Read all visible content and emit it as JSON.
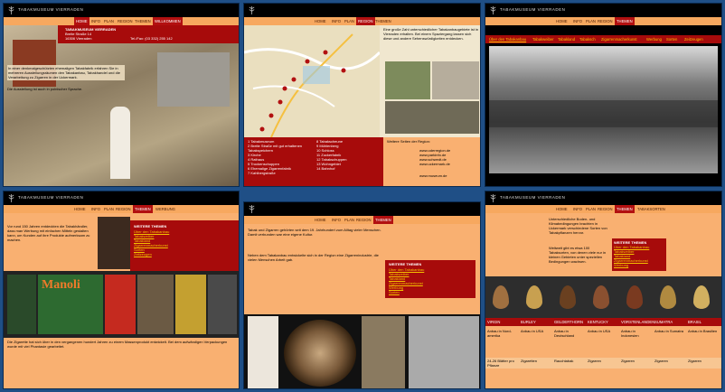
{
  "site_title": "TABAKMUSEUM VIERRADEN",
  "nav": [
    "HOME",
    "INFO",
    "PLAN",
    "REGION",
    "THEMEN"
  ],
  "panels": {
    "p1": {
      "active": "HOME",
      "sub": "WILLKOMMEN",
      "address": [
        "TABAKMUSEUM VIERRADEN",
        "Breite Straße 14",
        "16306 Vierraden",
        "Tel./Fax: (03 332) 255 142"
      ],
      "intro": "In einer denkmalgeschützten ehemaligen Tabakfabrik erfahren Sie in mehreren Ausstellungsräumen den Tabakanbau, Tabakhandel und die Verarbeitung zu Zigarren in der Uckermark.",
      "english": "Die Ausstellung ist auch in polnischer Sprache."
    },
    "p2": {
      "active": "REGION",
      "intro": "Eine große Zahl unterschiedlicher Tabakanbaugebiete ist in Vierraden erhalten. Bei einem Spaziergang lassen sich diese und andere Sehenswürdigkeiten entdecken.",
      "list_left": [
        "1 Tabakmuseum",
        "2 Breite Straße mit gut erhaltenen Tabakspeichern",
        "3 Kirche",
        "4 Rathaus",
        "5 Trockenschuppen",
        "6 Ehemalige Zigarrenfabrik",
        "7 Kahlbergstraße"
      ],
      "list_right": [
        "8 Tabakscheune",
        "9 Mühlenberg",
        "10 Schloss",
        "11 Zuckerfabrik",
        "12 Tabakschuppen",
        "13 Wohngebiet",
        "14 Bahnhof"
      ],
      "links_title": "Weitere Seiten der Region:",
      "links": [
        "www.oderregion.de",
        "www.parkinfo.de",
        "www.schwedt.de",
        "www.uckermark.de",
        "www.museum.de"
      ]
    },
    "p3": {
      "tabs": [
        "Über den Tabakanbau",
        "Tabakweiber",
        "Tabakland",
        "Tabaksch",
        "Zigarrenmacherkunst",
        "Werbung",
        "Sorten",
        "Zeitzeugen"
      ]
    },
    "p4": {
      "active": "THEMEN",
      "sub": "WERBUNG",
      "intro": "Vor rund 150 Jahren entdeckten die Tabakhändler, dass man Werbung mit einfachen Mitteln gestalten kann, um Kunden auf ihre Produkte aufmerksam zu machen.",
      "sidebar_title": "WEITERE THEMEN",
      "sidebar_links": [
        "Über den Tabakanbau",
        "Tabakweiber",
        "Tabakland",
        "Zigarrenmacherkunst",
        "Sorten",
        "Zeitzeugen"
      ],
      "poster_text": "Manoli",
      "footer": "Die Zigarette hat sich über in den vergangenen hundert Jahren zu einem Massenprodukt entwickelt. Bei dem aufwändigen Verpackungen wurde mit viel Phantasie gearbeitet."
    },
    "p5": {
      "active": "THEMEN",
      "intro": "Tabak und Zigarren gehörten seit dem 19. Jahrhundert zum Alltag vieler Menschen. Damit verbunden war eine eigene Kultur.",
      "body": "Neben dem Tabakanbau entwickelte sich in der Region eine Zigarrenindustrie, die vielen Menschen Arbeit gab.",
      "sidebar_title": "WEITERE THEMEN",
      "sidebar_links": [
        "Über den Tabakanbau",
        "Tabakweiber",
        "Tabakland",
        "Zigarrenmacherkunst",
        "Werbung",
        "Sorten"
      ]
    },
    "p6": {
      "active": "THEMEN",
      "sub": "TABAKSORTEN",
      "intro": "Unterschiedliche Boden- und Klimabedingungen brachten in Uckermark verschiedene Sorten von Tabakpflanzen hervor.",
      "body": "Weltweit gibt es etwa 100 Tabaksorten, von denen viele nur in kleinen Gebieten unter speziellen Bedingungen wachsen.",
      "sidebar_title": "WEITERE THEMEN",
      "sidebar_links": [
        "Über den Tabakanbau",
        "Tabakweiber",
        "Tabakland",
        "Zigarrenmacherkunst",
        "Werbung",
        "Zeitzeugen"
      ],
      "table_headers": [
        "VIRGIN",
        "BURLEY",
        "GELDERTHORN",
        "KENTUCKY",
        "VORSTENLANDEN",
        "SUMATRA",
        "BRASIL"
      ],
      "row1": [
        "Anbau in Nord-amerika",
        "Anbau in USA",
        "Anbau in Deutschland",
        "Anbau in USA",
        "Anbau in Indonesien",
        "Anbau in Sumatra",
        "Anbau in Brasilien"
      ],
      "row2": [
        "24-26 Blätter pro Pflanze",
        "Zigaretten",
        "Rauchtabak",
        "Zigarren",
        "Zigarren",
        "Zigarren",
        "Zigarren"
      ]
    }
  }
}
